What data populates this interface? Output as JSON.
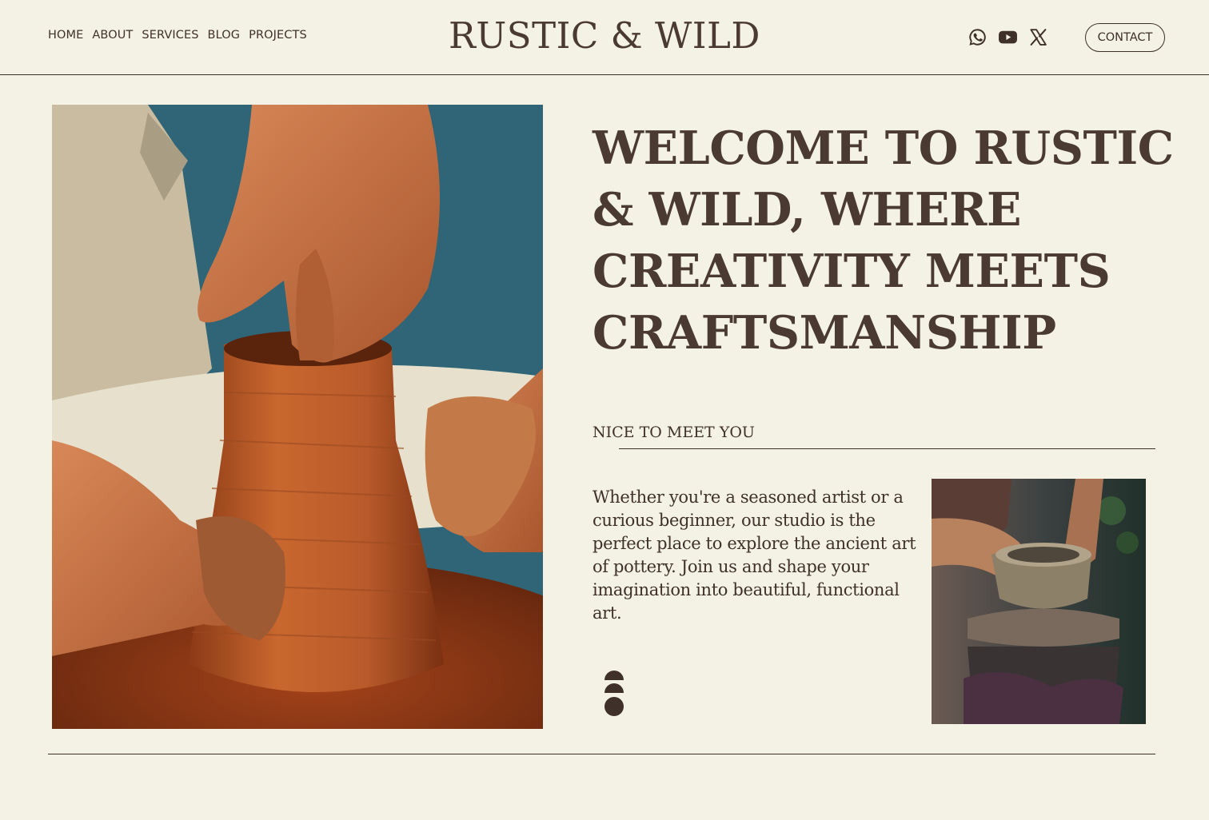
{
  "nav": {
    "items": [
      {
        "label": "HOME"
      },
      {
        "label": "ABOUT"
      },
      {
        "label": "SERVICES"
      },
      {
        "label": "BLOG"
      },
      {
        "label": "PROJECTS"
      }
    ]
  },
  "brand": {
    "title": "RUSTIC & WILD"
  },
  "social": {
    "icons": [
      "whatsapp-icon",
      "youtube-icon",
      "x-icon"
    ]
  },
  "header": {
    "contact_label": "CONTACT"
  },
  "hero": {
    "headline": "WELCOME TO RUSTIC & WILD, WHERE CREATIVITY MEETS CRAFTSMANSHIP",
    "section_label": "NICE TO MEET YOU",
    "intro": "Whether you're a seasoned artist or a curious beginner, our studio is the perfect place to explore the ancient art of pottery. Join us and shape your imagination into beautiful, functional art."
  },
  "colors": {
    "background": "#f3f2e5",
    "text": "#4a3a31",
    "clay": "#b8643a",
    "teal": "#2f6576"
  }
}
